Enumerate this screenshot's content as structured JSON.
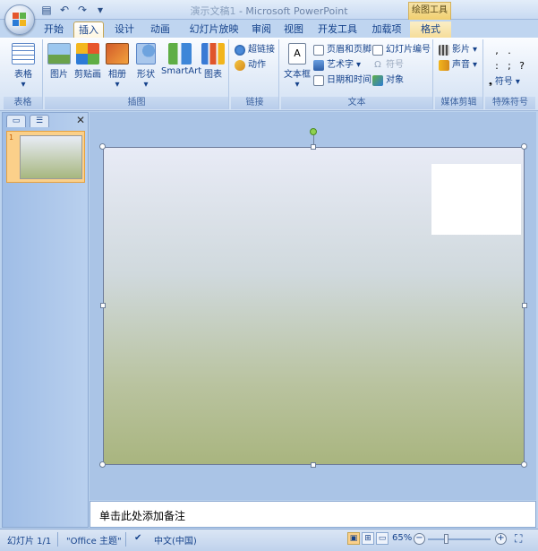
{
  "titlebar": {
    "doc_name": "演示文稿1",
    "app_name": "Microsoft PowerPoint",
    "context_group": "绘图工具",
    "qat": [
      "save-icon",
      "undo-icon",
      "redo-icon",
      "customize-icon"
    ]
  },
  "tabs": [
    {
      "label": "开始"
    },
    {
      "label": "插入"
    },
    {
      "label": "设计"
    },
    {
      "label": "动画"
    },
    {
      "label": "幻灯片放映"
    },
    {
      "label": "审阅"
    },
    {
      "label": "视图"
    },
    {
      "label": "开发工具"
    },
    {
      "label": "加载项"
    },
    {
      "label": "格式"
    }
  ],
  "ribbon": {
    "groups": {
      "table": "表格",
      "illustrations": "插图",
      "links": "链接",
      "text": "文本",
      "media": "媒体剪辑",
      "symbols": "特殊符号"
    },
    "buttons": {
      "table": "表格",
      "picture": "图片",
      "clipart": "剪贴画",
      "album": "相册",
      "shapes": "形状",
      "smartart": "SmartArt",
      "chart": "图表",
      "hyperlink": "超链接",
      "action": "动作",
      "textbox": "文本框",
      "header_footer": "页眉和页脚",
      "wordart": "艺术字",
      "datetime": "日期和时间",
      "slide_number": "幻灯片编号",
      "symbol": "符号",
      "object": "对象",
      "movie": "影片",
      "sound": "声音",
      "special_symbol": "符号"
    },
    "symbols_grid": [
      ",",
      ".",
      ":",
      ";",
      "?",
      "!"
    ]
  },
  "notes": {
    "placeholder": "单击此处添加备注"
  },
  "status": {
    "slide": "幻灯片 1/1",
    "theme": "\"Office 主题\"",
    "language": "中文(中国)",
    "zoom": "65%",
    "zoom_fraction": 0.65
  }
}
